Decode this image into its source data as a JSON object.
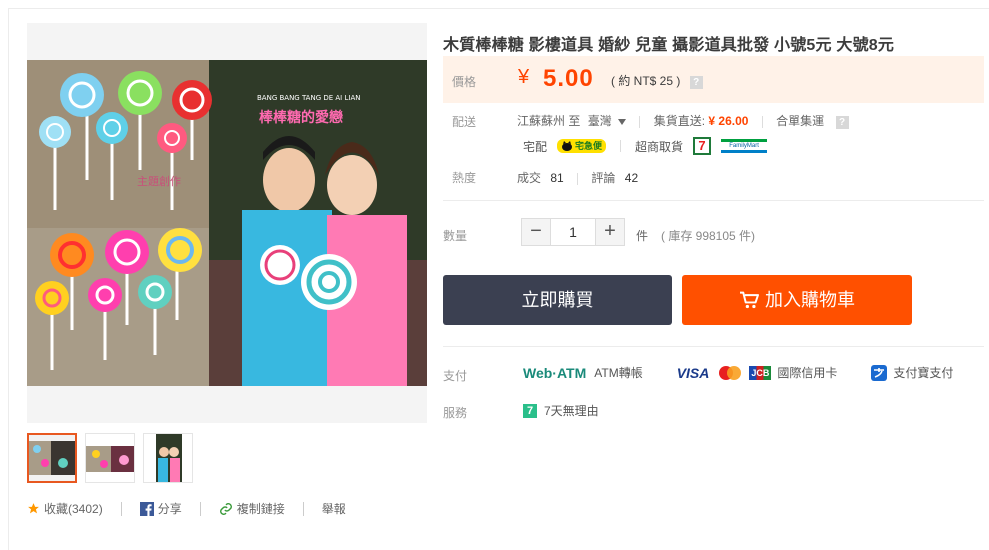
{
  "product": {
    "title": "木質棒棒糖 影樓道具 婚紗 兒童 攝影道具批發 小號5元 大號8元",
    "photo_banner_text": "BANG BANG TANG DE AI LIAN",
    "photo_caption": "棒棒糖的愛戀",
    "photo_watermark": "主題創作"
  },
  "price": {
    "label": "價格",
    "symbol": "¥",
    "value": "5.00",
    "ntd_text": "( 約 NT$ 25 )",
    "help": "?"
  },
  "shipping": {
    "label": "配送",
    "route": "江蘇蘇州 至",
    "destination": "臺灣",
    "direct_label": "集貨直送:",
    "direct_price": "¥ 26.00",
    "combine": "合單集運",
    "help": "?",
    "home": "宅配",
    "cvs": "超商取貨",
    "kuroneko": "宅急便",
    "seven_eleven": "7",
    "familymart": "FamilyMart"
  },
  "heat": {
    "label": "熱度",
    "sales_label": "成交",
    "sales": "81",
    "reviews_label": "評論",
    "reviews": "42"
  },
  "quantity": {
    "label": "數量",
    "minus": "−",
    "plus": "+",
    "value": "1",
    "unit": "件",
    "stock": "( 庫存 998105 件)"
  },
  "buttons": {
    "buy_now": "立即購買",
    "add_cart": "加入購物車"
  },
  "payment": {
    "label": "支付",
    "webatm_logo": "Web·ATM",
    "atm": "ATM轉帳",
    "visa": "VISA",
    "jcb": "JCB",
    "intl_card": "國際信用卡",
    "alipay": "支付寶支付"
  },
  "service": {
    "label": "服務",
    "badge": "7",
    "text": "7天無理由"
  },
  "social": {
    "favorite": "收藏(3402)",
    "share": "分享",
    "copy_link": "複制鏈接",
    "report": "舉報"
  },
  "colors": {
    "accent": "#ff4400",
    "cart_button": "#ff5000",
    "buy_button": "#3b4051",
    "price_bg": "#fff2e8"
  }
}
